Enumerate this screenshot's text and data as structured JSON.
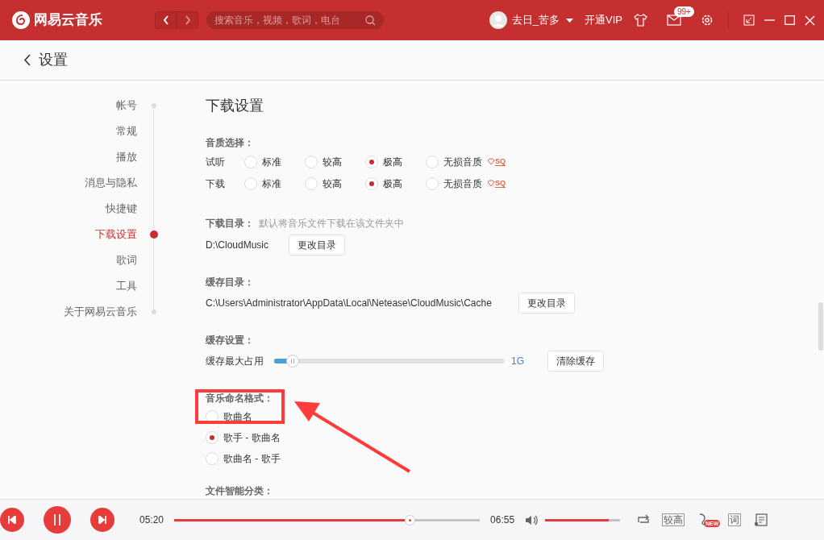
{
  "app": {
    "name": "网易云音乐"
  },
  "search": {
    "placeholder": "搜索音乐，视频，歌词，电台"
  },
  "user": {
    "name": "去日_苦多"
  },
  "vip": "开通VIP",
  "mail_badge": "99+",
  "page_title": "设置",
  "sidebar": {
    "items": [
      {
        "label": "帐号",
        "selected": false
      },
      {
        "label": "常规",
        "selected": false
      },
      {
        "label": "播放",
        "selected": false
      },
      {
        "label": "消息与隐私",
        "selected": false
      },
      {
        "label": "快捷键",
        "selected": false
      },
      {
        "label": "下载设置",
        "selected": true
      },
      {
        "label": "歌词",
        "selected": false
      },
      {
        "label": "工具",
        "selected": false
      },
      {
        "label": "关于网易云音乐",
        "selected": false
      }
    ]
  },
  "section_title": "下载设置",
  "quality": {
    "label": "音质选择：",
    "rows": [
      {
        "label": "试听",
        "options": [
          {
            "label": "标准",
            "selected": false
          },
          {
            "label": "较高",
            "selected": false
          },
          {
            "label": "极高",
            "selected": true
          },
          {
            "label": "无损音质",
            "selected": false,
            "badge": "SQ"
          }
        ]
      },
      {
        "label": "下载",
        "options": [
          {
            "label": "标准",
            "selected": false
          },
          {
            "label": "较高",
            "selected": false
          },
          {
            "label": "极高",
            "selected": true
          },
          {
            "label": "无损音质",
            "selected": false,
            "badge": "SQ"
          }
        ]
      }
    ]
  },
  "download_dir": {
    "label": "下载目录：",
    "hint": "默认将音乐文件下载在该文件夹中",
    "path": "D:\\CloudMusic",
    "button": "更改目录"
  },
  "cache_dir": {
    "label": "缓存目录：",
    "path": "C:\\Users\\Administrator\\AppData\\Local\\Netease\\CloudMusic\\Cache",
    "button": "更改目录"
  },
  "cache_settings": {
    "label": "缓存设置：",
    "slider_label": "缓存最大占用",
    "level": 0.08,
    "reading": "1G",
    "button": "清除缓存"
  },
  "naming": {
    "label": "音乐命名格式：",
    "options": [
      {
        "label": "歌曲名",
        "selected": false
      },
      {
        "label": "歌手 - 歌曲名",
        "selected": true
      },
      {
        "label": "歌曲名 - 歌手",
        "selected": false
      }
    ]
  },
  "smart_folder": {
    "label": "文件智能分类："
  },
  "player": {
    "elapsed": "05:20",
    "progress": {
      "level": 0.77
    },
    "total": "06:55",
    "volume": {
      "level": 0.85
    },
    "quality": "较高",
    "new_badge": "NEW",
    "lyrics": "词"
  }
}
